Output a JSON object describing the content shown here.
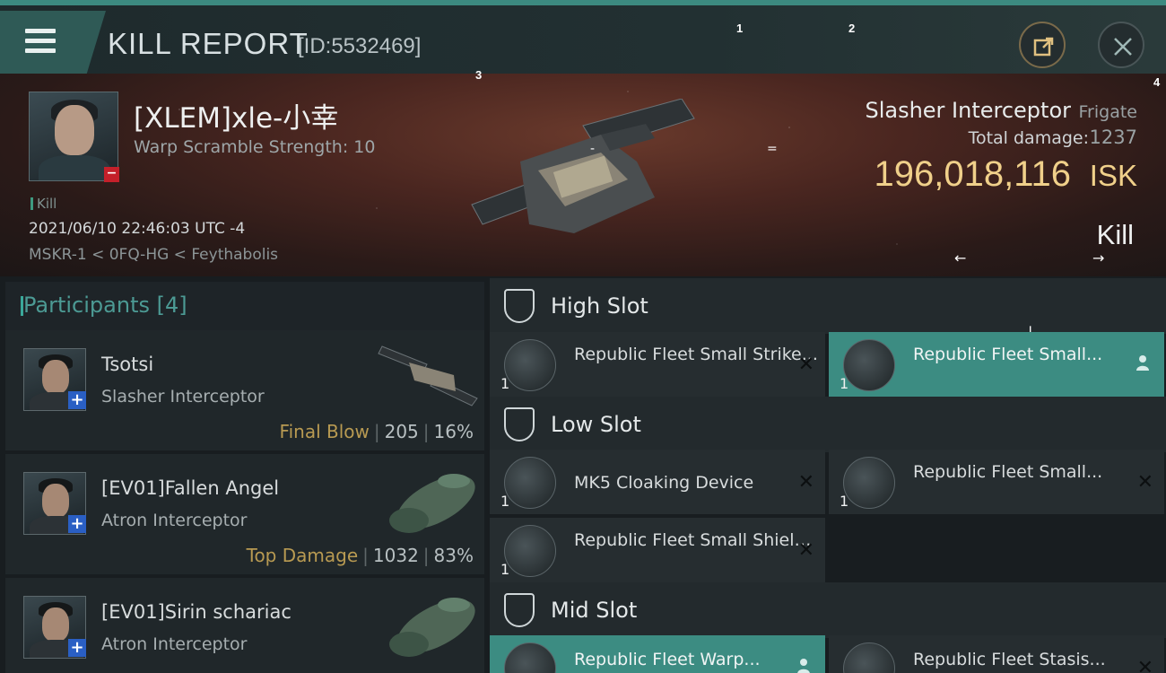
{
  "header": {
    "title": "KILL REPORT",
    "kill_id": "[ID:5532469]",
    "markers": [
      "1",
      "2",
      "3",
      "4"
    ]
  },
  "hero": {
    "victim_name": "[XLEM]xle-小幸",
    "warp_scramble": "Warp Scramble Strength: 10",
    "tag": "Kill",
    "datetime": "2021/06/10 22:46:03 UTC -4",
    "location": "MSKR-1 < 0FQ-HG < Feythabolis",
    "ship_name": "Slasher Interceptor",
    "ship_class": "Frigate",
    "total_damage_label": "Total damage:",
    "total_damage": "1237",
    "isk_value": "196,018,116",
    "isk_unit": "ISK",
    "result": "Kill",
    "arrow_left": "←",
    "arrow_right": "→",
    "eq": "=",
    "dash": "-"
  },
  "participants": {
    "title": "Participants",
    "count": "[4]",
    "list": [
      {
        "name": "Tsotsi",
        "ship": "Slasher Interceptor",
        "stat_label": "Final Blow",
        "damage": "205",
        "percent": "16%"
      },
      {
        "name": "[EV01]Fallen Angel",
        "ship": "Atron Interceptor",
        "stat_label": "Top Damage",
        "damage": "1032",
        "percent": "83%"
      },
      {
        "name": "[EV01]Sirin schariac",
        "ship": "Atron Interceptor",
        "stat_label": "",
        "damage": "",
        "percent": ""
      }
    ]
  },
  "fitting": {
    "high_slot": {
      "title": "High Slot",
      "modules": [
        {
          "name": "Republic Fleet Small Strike...",
          "qty": "1",
          "active": false
        },
        {
          "name": "Republic Fleet Small...",
          "qty": "1",
          "active": true
        }
      ]
    },
    "low_slot": {
      "title": "Low Slot",
      "modules": [
        {
          "name": "MK5 Cloaking Device",
          "qty": "1",
          "active": false
        },
        {
          "name": "Republic Fleet Small...",
          "qty": "1",
          "active": false
        },
        {
          "name": "Republic Fleet Small Shield...",
          "qty": "1",
          "active": false
        }
      ]
    },
    "mid_slot": {
      "title": "Mid Slot",
      "modules": [
        {
          "name": "Republic Fleet Warp...",
          "qty": "",
          "active": true
        },
        {
          "name": "Republic Fleet Stasis...",
          "qty": "",
          "active": false
        }
      ]
    },
    "down_arrow": "↓"
  },
  "colors": {
    "accent": "#3c8c82",
    "isk": "#f0d08a",
    "final_blow": "#b89a52"
  }
}
